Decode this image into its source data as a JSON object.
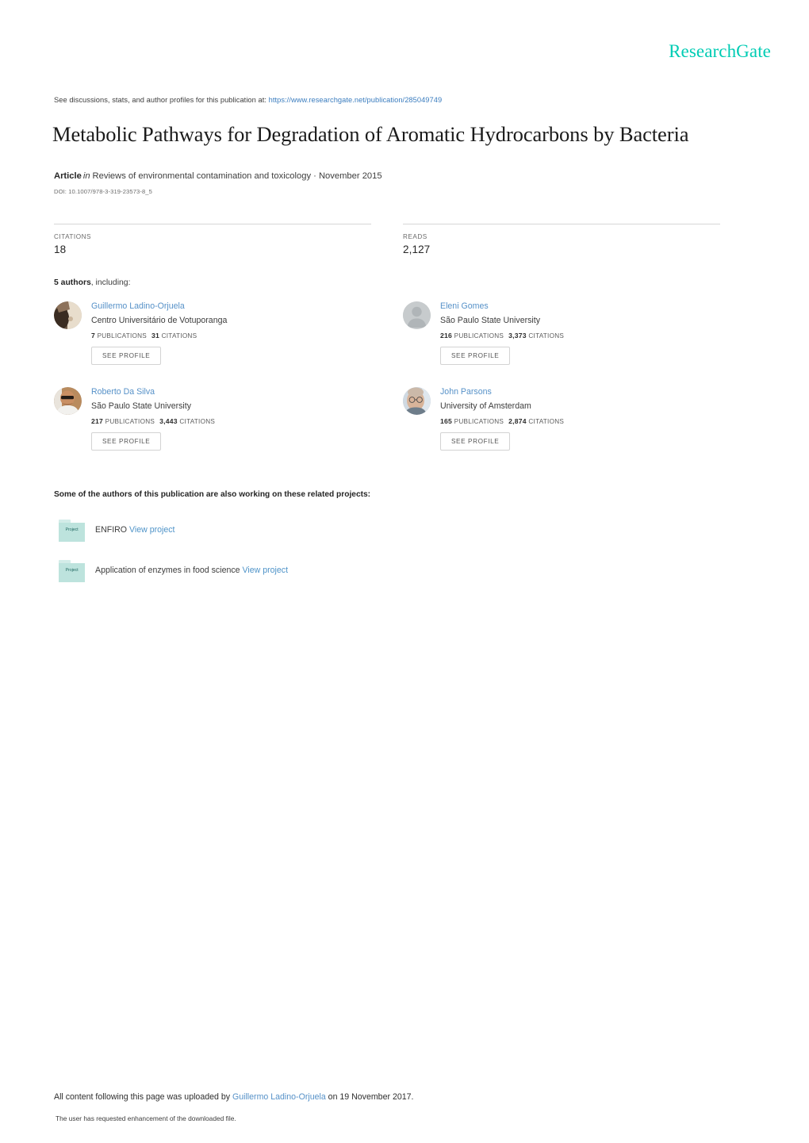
{
  "brand": {
    "logo_text": "ResearchGate",
    "logo_color": "#00ccb4"
  },
  "header": {
    "discussions_prefix": "See discussions, stats, and author profiles for this publication at:",
    "publication_url": "https://www.researchgate.net/publication/285049749",
    "title": "Metabolic Pathways for Degradation of Aromatic Hydrocarbons by Bacteria"
  },
  "article": {
    "type_label": "Article",
    "in_word": "in",
    "source": "Reviews of environmental contamination and toxicology · November 2015",
    "doi": "DOI: 10.1007/978-3-319-23573-8_5"
  },
  "stats": {
    "citations_label": "CITATIONS",
    "citations_value": "18",
    "reads_label": "READS",
    "reads_value": "2,127"
  },
  "authors_section": {
    "heading_count": "5 authors",
    "heading_rest": ", including:",
    "see_profile_label": "SEE PROFILE",
    "publications_label": "PUBLICATIONS",
    "citations_label": "CITATIONS",
    "authors": [
      {
        "name": "Guillermo Ladino-Orjuela",
        "affiliation": "Centro Universitário de Votuporanga",
        "publications": "7",
        "citations": "31",
        "avatar": "photo-person-dark"
      },
      {
        "name": "Eleni Gomes",
        "affiliation": "São Paulo State University",
        "publications": "216",
        "citations": "3,373",
        "avatar": "placeholder-person-icon"
      },
      {
        "name": "Roberto Da Silva",
        "affiliation": "São Paulo State University",
        "publications": "217",
        "citations": "3,443",
        "avatar": "photo-person-sunglasses"
      },
      {
        "name": "John Parsons",
        "affiliation": "University of Amsterdam",
        "publications": "165",
        "citations": "2,874",
        "avatar": "photo-person-glasses"
      }
    ]
  },
  "projects_section": {
    "heading": "Some of the authors of this publication are also working on these related projects:",
    "folder_glyph_text": "Project",
    "projects": [
      {
        "name": "ENFIRO",
        "link_label": "View project"
      },
      {
        "name": "Application of enzymes in food science",
        "link_label": "View project"
      }
    ]
  },
  "footer": {
    "line_prefix": "All content following this page was uploaded by ",
    "uploader": "Guillermo Ladino-Orjuela",
    "line_suffix": " on 19 November 2017.",
    "sub_line": "The user has requested enhancement of the downloaded file."
  }
}
